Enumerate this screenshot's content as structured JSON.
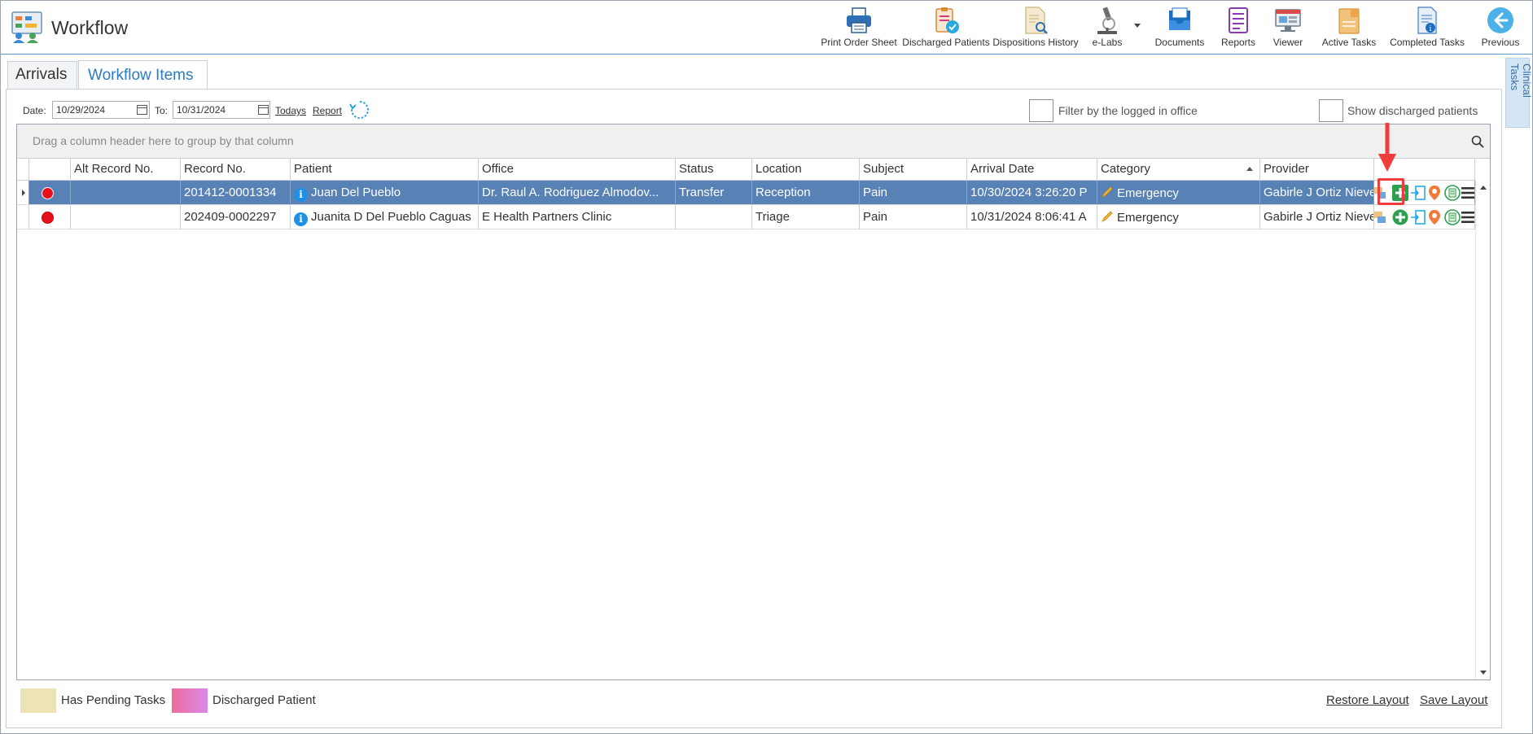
{
  "app": {
    "title": "Workflow"
  },
  "toolbar": [
    {
      "id": "print-order-sheet",
      "label": "Print Order Sheet",
      "icon": "printer-icon"
    },
    {
      "id": "discharged-patients",
      "label": "Discharged Patients",
      "icon": "clipboard-check-icon"
    },
    {
      "id": "dispositions-history",
      "label": "Dispositions History",
      "icon": "document-search-icon"
    },
    {
      "id": "e-labs",
      "label": "e-Labs",
      "icon": "microscope-icon"
    },
    {
      "id": "documents",
      "label": "Documents",
      "icon": "inbox-tray-icon"
    },
    {
      "id": "reports",
      "label": "Reports",
      "icon": "report-icon"
    },
    {
      "id": "viewer",
      "label": "Viewer",
      "icon": "monitor-icon"
    },
    {
      "id": "active-tasks",
      "label": "Active Tasks",
      "icon": "tasks-folder-icon"
    },
    {
      "id": "completed-tasks",
      "label": "Completed Tasks",
      "icon": "completed-doc-icon"
    },
    {
      "id": "previous",
      "label": "Previous",
      "icon": "back-arrow-icon"
    }
  ],
  "side_panel": {
    "label": "Clinical Tasks"
  },
  "tabs": [
    {
      "label": "Arrivals",
      "active": false
    },
    {
      "label": "Workflow Items",
      "active": true
    }
  ],
  "filters": {
    "date_label": "Date:",
    "date_from": "10/29/2024",
    "to_label": "To:",
    "date_to": "10/31/2024",
    "todays_link": "Todays",
    "report_link": "Report",
    "filter_office_label": "Filter by the logged in office",
    "show_discharged_label": "Show discharged patients"
  },
  "grid": {
    "group_hint": "Drag a column header here to group by that column",
    "columns": [
      "",
      "Alt Record No.",
      "Record No.",
      "Patient",
      "Office",
      "Status",
      "Location",
      "Subject",
      "Arrival Date",
      "Category",
      "Provider",
      ""
    ],
    "sort_column": "Category",
    "rows": [
      {
        "selected": true,
        "alt_record": "",
        "record": "201412-0001334",
        "patient": "Juan Del Pueblo",
        "office": "Dr. Raul A. Rodriguez Almodov...",
        "status": "Transfer",
        "location": "Reception",
        "subject": "Pain",
        "arrival": "10/30/2024 3:26:20 P",
        "category": "Emergency",
        "provider": "Gabirle J Ortiz Nieve"
      },
      {
        "selected": false,
        "alt_record": "",
        "record": "202409-0002297",
        "patient": "Juanita D Del Pueblo Caguas",
        "office": "E Health Partners Clinic",
        "status": "",
        "location": "Triage",
        "subject": "Pain",
        "arrival": "10/31/2024 8:06:41 A",
        "category": "Emergency",
        "provider": "Gabirle J Ortiz Nieve"
      }
    ]
  },
  "legend": {
    "pending_label": "Has Pending Tasks",
    "pending_color": "#ece3b6",
    "discharged_label": "Discharged Patient",
    "discharged_color_start": "#f06a9d",
    "discharged_color_end": "#d98ae8"
  },
  "layout_links": {
    "restore": "Restore Layout",
    "save": "Save Layout"
  },
  "colors": {
    "accent": "#2b7bc7",
    "selected_row": "#5881b6",
    "status_dot": "#e8111b",
    "annotation": "#f03c3c"
  }
}
